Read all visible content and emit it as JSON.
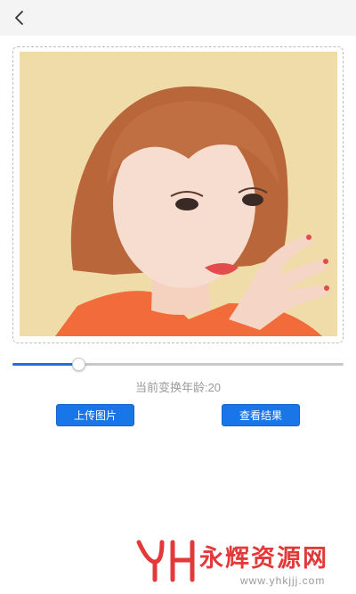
{
  "header": {
    "back_icon": "chevron-left-icon"
  },
  "photo": {
    "alt": "portrait photo"
  },
  "age_slider": {
    "fraction": 0.2
  },
  "age_label": "当前变换年龄:20",
  "buttons": {
    "upload_label": "上传图片",
    "result_label": "查看结果"
  },
  "watermark": {
    "title": "永辉资源网",
    "url": "www.yhkjjj.com"
  },
  "colors": {
    "accent": "#1976e8",
    "slider_fill": "#1e6fd9",
    "watermark": "#e23a3a"
  }
}
